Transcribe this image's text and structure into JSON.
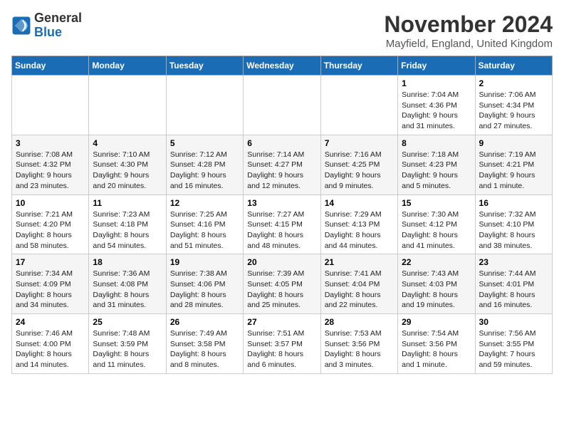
{
  "header": {
    "logo_line1": "General",
    "logo_line2": "Blue",
    "month_year": "November 2024",
    "location": "Mayfield, England, United Kingdom"
  },
  "days_of_week": [
    "Sunday",
    "Monday",
    "Tuesday",
    "Wednesday",
    "Thursday",
    "Friday",
    "Saturday"
  ],
  "weeks": [
    [
      {
        "day": "",
        "info": ""
      },
      {
        "day": "",
        "info": ""
      },
      {
        "day": "",
        "info": ""
      },
      {
        "day": "",
        "info": ""
      },
      {
        "day": "",
        "info": ""
      },
      {
        "day": "1",
        "info": "Sunrise: 7:04 AM\nSunset: 4:36 PM\nDaylight: 9 hours and 31 minutes."
      },
      {
        "day": "2",
        "info": "Sunrise: 7:06 AM\nSunset: 4:34 PM\nDaylight: 9 hours and 27 minutes."
      }
    ],
    [
      {
        "day": "3",
        "info": "Sunrise: 7:08 AM\nSunset: 4:32 PM\nDaylight: 9 hours and 23 minutes."
      },
      {
        "day": "4",
        "info": "Sunrise: 7:10 AM\nSunset: 4:30 PM\nDaylight: 9 hours and 20 minutes."
      },
      {
        "day": "5",
        "info": "Sunrise: 7:12 AM\nSunset: 4:28 PM\nDaylight: 9 hours and 16 minutes."
      },
      {
        "day": "6",
        "info": "Sunrise: 7:14 AM\nSunset: 4:27 PM\nDaylight: 9 hours and 12 minutes."
      },
      {
        "day": "7",
        "info": "Sunrise: 7:16 AM\nSunset: 4:25 PM\nDaylight: 9 hours and 9 minutes."
      },
      {
        "day": "8",
        "info": "Sunrise: 7:18 AM\nSunset: 4:23 PM\nDaylight: 9 hours and 5 minutes."
      },
      {
        "day": "9",
        "info": "Sunrise: 7:19 AM\nSunset: 4:21 PM\nDaylight: 9 hours and 1 minute."
      }
    ],
    [
      {
        "day": "10",
        "info": "Sunrise: 7:21 AM\nSunset: 4:20 PM\nDaylight: 8 hours and 58 minutes."
      },
      {
        "day": "11",
        "info": "Sunrise: 7:23 AM\nSunset: 4:18 PM\nDaylight: 8 hours and 54 minutes."
      },
      {
        "day": "12",
        "info": "Sunrise: 7:25 AM\nSunset: 4:16 PM\nDaylight: 8 hours and 51 minutes."
      },
      {
        "day": "13",
        "info": "Sunrise: 7:27 AM\nSunset: 4:15 PM\nDaylight: 8 hours and 48 minutes."
      },
      {
        "day": "14",
        "info": "Sunrise: 7:29 AM\nSunset: 4:13 PM\nDaylight: 8 hours and 44 minutes."
      },
      {
        "day": "15",
        "info": "Sunrise: 7:30 AM\nSunset: 4:12 PM\nDaylight: 8 hours and 41 minutes."
      },
      {
        "day": "16",
        "info": "Sunrise: 7:32 AM\nSunset: 4:10 PM\nDaylight: 8 hours and 38 minutes."
      }
    ],
    [
      {
        "day": "17",
        "info": "Sunrise: 7:34 AM\nSunset: 4:09 PM\nDaylight: 8 hours and 34 minutes."
      },
      {
        "day": "18",
        "info": "Sunrise: 7:36 AM\nSunset: 4:08 PM\nDaylight: 8 hours and 31 minutes."
      },
      {
        "day": "19",
        "info": "Sunrise: 7:38 AM\nSunset: 4:06 PM\nDaylight: 8 hours and 28 minutes."
      },
      {
        "day": "20",
        "info": "Sunrise: 7:39 AM\nSunset: 4:05 PM\nDaylight: 8 hours and 25 minutes."
      },
      {
        "day": "21",
        "info": "Sunrise: 7:41 AM\nSunset: 4:04 PM\nDaylight: 8 hours and 22 minutes."
      },
      {
        "day": "22",
        "info": "Sunrise: 7:43 AM\nSunset: 4:03 PM\nDaylight: 8 hours and 19 minutes."
      },
      {
        "day": "23",
        "info": "Sunrise: 7:44 AM\nSunset: 4:01 PM\nDaylight: 8 hours and 16 minutes."
      }
    ],
    [
      {
        "day": "24",
        "info": "Sunrise: 7:46 AM\nSunset: 4:00 PM\nDaylight: 8 hours and 14 minutes."
      },
      {
        "day": "25",
        "info": "Sunrise: 7:48 AM\nSunset: 3:59 PM\nDaylight: 8 hours and 11 minutes."
      },
      {
        "day": "26",
        "info": "Sunrise: 7:49 AM\nSunset: 3:58 PM\nDaylight: 8 hours and 8 minutes."
      },
      {
        "day": "27",
        "info": "Sunrise: 7:51 AM\nSunset: 3:57 PM\nDaylight: 8 hours and 6 minutes."
      },
      {
        "day": "28",
        "info": "Sunrise: 7:53 AM\nSunset: 3:56 PM\nDaylight: 8 hours and 3 minutes."
      },
      {
        "day": "29",
        "info": "Sunrise: 7:54 AM\nSunset: 3:56 PM\nDaylight: 8 hours and 1 minute."
      },
      {
        "day": "30",
        "info": "Sunrise: 7:56 AM\nSunset: 3:55 PM\nDaylight: 7 hours and 59 minutes."
      }
    ]
  ]
}
